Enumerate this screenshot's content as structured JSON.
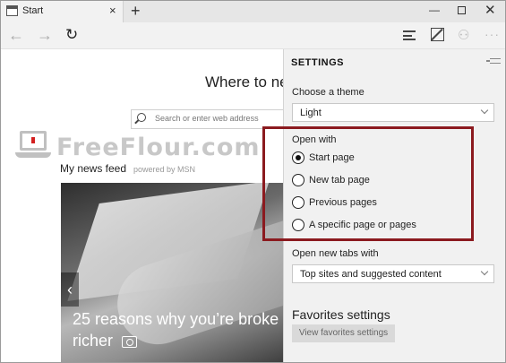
{
  "tab": {
    "title": "Start",
    "close": "×"
  },
  "tabbar": {
    "new_tab": "+",
    "minimize": "—",
    "close": "✕"
  },
  "nav": {
    "back": "←",
    "forward": "→",
    "refresh": "↻",
    "share": "⚇",
    "more": "···"
  },
  "main": {
    "heading": "Where to ne",
    "search_placeholder": "Search or enter web address",
    "feed_title": "My news feed",
    "feed_subtitle": "powered by MSN",
    "hero_prev": "‹",
    "hero_caption_line1": "25 reasons why you’re broke",
    "hero_caption_line2": "richer"
  },
  "watermark": {
    "text": "FreeFlour.com",
    "accent": "#d32020"
  },
  "settings": {
    "title": "SETTINGS",
    "theme_label": "Choose a theme",
    "theme_value": "Light",
    "open_with_label": "Open with",
    "open_with_options": [
      {
        "label": "Start page",
        "checked": true
      },
      {
        "label": "New tab page",
        "checked": false
      },
      {
        "label": "Previous pages",
        "checked": false
      },
      {
        "label": "A specific page or pages",
        "checked": false
      }
    ],
    "new_tabs_label": "Open new tabs with",
    "new_tabs_value": "Top sites and suggested content",
    "favorites_heading": "Favorites settings",
    "favorites_button": "View favorites settings"
  },
  "colors": {
    "highlight": "#8b1a1f",
    "panel_bg": "#f1f1f1"
  }
}
